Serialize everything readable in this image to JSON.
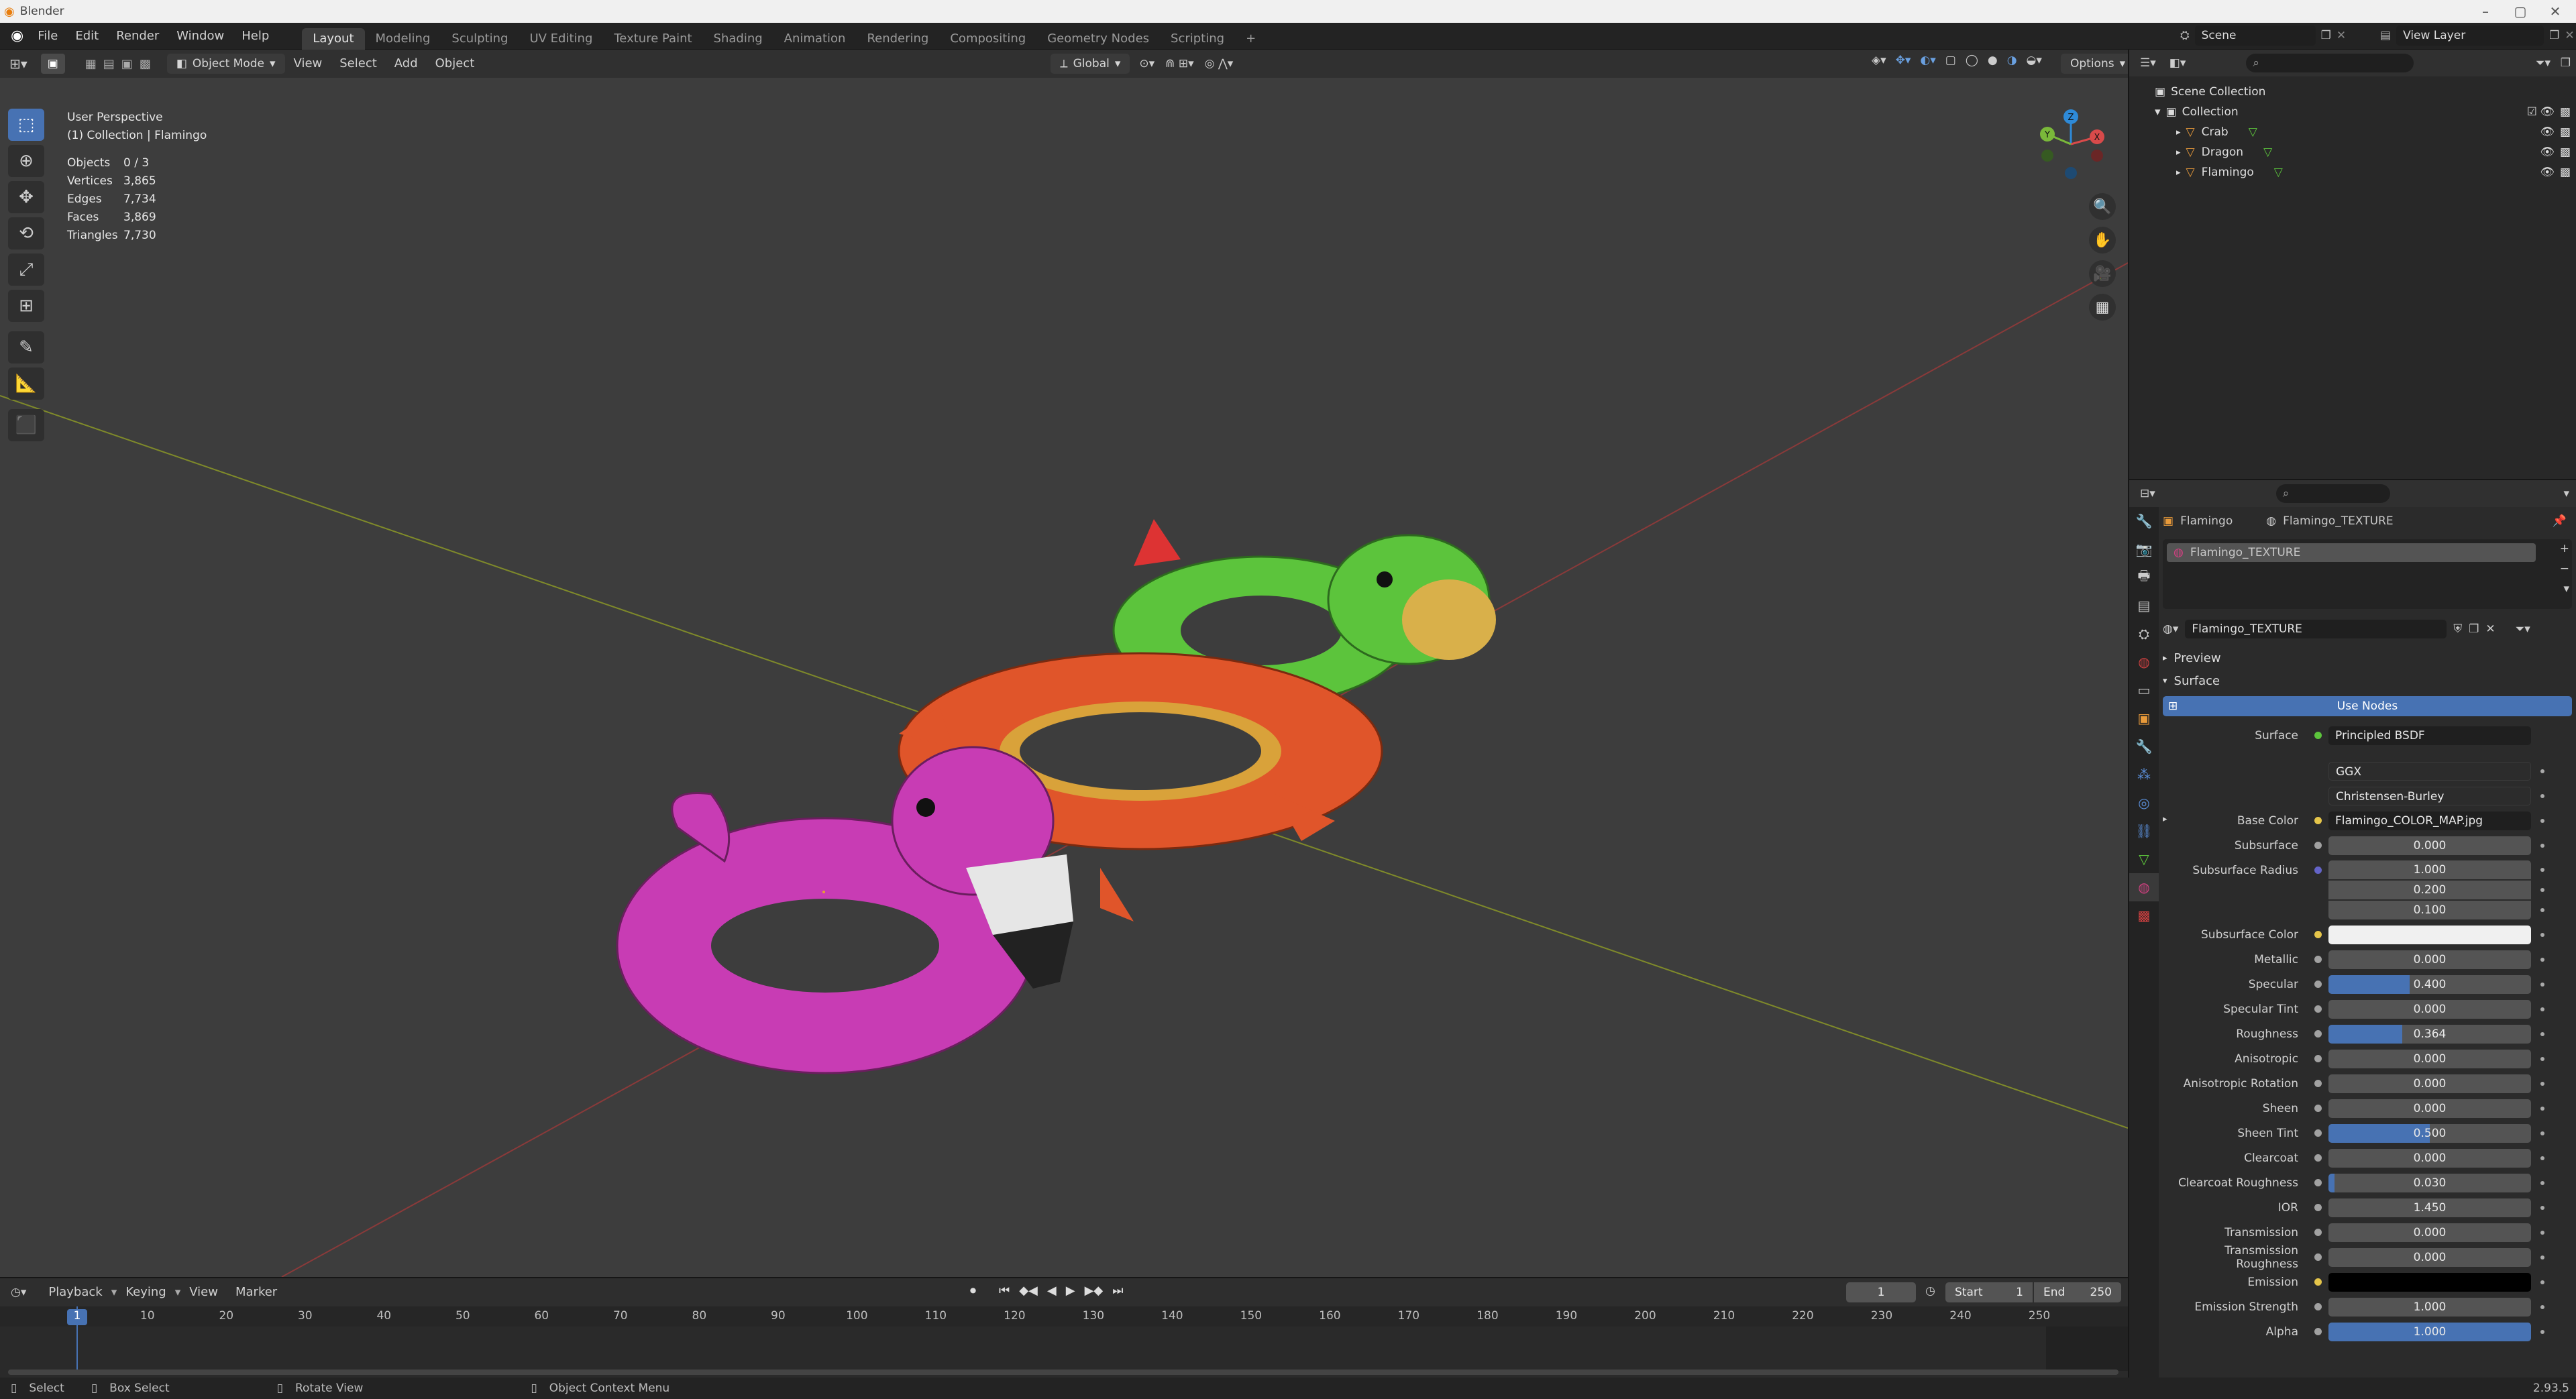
{
  "window": {
    "title": "Blender"
  },
  "menu": [
    "File",
    "Edit",
    "Render",
    "Window",
    "Help"
  ],
  "workspaces": [
    "Layout",
    "Modeling",
    "Sculpting",
    "UV Editing",
    "Texture Paint",
    "Shading",
    "Animation",
    "Rendering",
    "Compositing",
    "Geometry Nodes",
    "Scripting"
  ],
  "top_right": {
    "scene": "Scene",
    "view_layer": "View Layer"
  },
  "viewport_header": {
    "mode": "Object Mode",
    "menus": [
      "View",
      "Select",
      "Add",
      "Object"
    ],
    "orientation": "Global",
    "options": "Options"
  },
  "viewport": {
    "perspective": "User Perspective",
    "collection": "(1) Collection | Flamingo",
    "stats": [
      {
        "k": "Objects",
        "v": "0 / 3"
      },
      {
        "k": "Vertices",
        "v": "3,865"
      },
      {
        "k": "Edges",
        "v": "7,734"
      },
      {
        "k": "Faces",
        "v": "3,869"
      },
      {
        "k": "Triangles",
        "v": "7,730"
      }
    ],
    "gizmo": {
      "x": "X",
      "y": "Y",
      "z": "Z"
    }
  },
  "timeline": {
    "menus": [
      "Playback",
      "Keying",
      "View",
      "Marker"
    ],
    "current_frame": "1",
    "start_label": "Start",
    "start": "1",
    "end_label": "End",
    "end": "250",
    "ticks": [
      "10",
      "20",
      "30",
      "40",
      "50",
      "60",
      "70",
      "80",
      "90",
      "100",
      "110",
      "120",
      "130",
      "140",
      "150",
      "160",
      "170",
      "180",
      "190",
      "200",
      "210",
      "220",
      "230",
      "240",
      "250"
    ],
    "playhead": "1"
  },
  "statusbar": {
    "select": "Select",
    "box_select": "Box Select",
    "rotate_view": "Rotate View",
    "context_menu": "Object Context Menu",
    "version": "2.93.5"
  },
  "outliner": {
    "root": "Scene Collection",
    "collection": "Collection",
    "objects": [
      "Crab",
      "Dragon",
      "Flamingo"
    ]
  },
  "properties": {
    "object": "Flamingo",
    "material_crumb": "Flamingo_TEXTURE",
    "slot": "Flamingo_TEXTURE",
    "material_name": "Flamingo_TEXTURE",
    "sections": {
      "preview": "Preview",
      "surface": "Surface"
    },
    "use_nodes": "Use Nodes",
    "surface_label": "Surface",
    "surface_value": "Principled BSDF",
    "distribution": "GGX",
    "subsurface_method": "Christensen-Burley",
    "base_color_label": "Base Color",
    "base_color_value": "Flamingo_COLOR_MAP.jpg",
    "subsurface_label": "Subsurface",
    "subsurface": "0.000",
    "subsurface_radius_label": "Subsurface Radius",
    "radius": [
      "1.000",
      "0.200",
      "0.100"
    ],
    "subsurface_color_label": "Subsurface Color",
    "params": [
      {
        "label": "Metallic",
        "value": "0.000",
        "fill": 0
      },
      {
        "label": "Specular",
        "value": "0.400",
        "fill": 0.4
      },
      {
        "label": "Specular Tint",
        "value": "0.000",
        "fill": 0
      },
      {
        "label": "Roughness",
        "value": "0.364",
        "fill": 0.364
      },
      {
        "label": "Anisotropic",
        "value": "0.000",
        "fill": 0
      },
      {
        "label": "Anisotropic Rotation",
        "value": "0.000",
        "fill": 0
      },
      {
        "label": "Sheen",
        "value": "0.000",
        "fill": 0
      },
      {
        "label": "Sheen Tint",
        "value": "0.500",
        "fill": 0.5
      },
      {
        "label": "Clearcoat",
        "value": "0.000",
        "fill": 0
      },
      {
        "label": "Clearcoat Roughness",
        "value": "0.030",
        "fill": 0.03
      },
      {
        "label": "IOR",
        "value": "1.450",
        "fill": 0
      },
      {
        "label": "Transmission",
        "value": "0.000",
        "fill": 0
      },
      {
        "label": "Transmission Roughness",
        "value": "0.000",
        "fill": 0
      }
    ],
    "emission_label": "Emission",
    "emission_strength_label": "Emission Strength",
    "emission_strength": "1.000",
    "alpha_label": "Alpha",
    "alpha": "1.000"
  },
  "colors": {
    "accent": "#4772b3",
    "flamingo": "#c83cb4",
    "crab": "#e0552a",
    "dragon": "#5cc43c"
  }
}
